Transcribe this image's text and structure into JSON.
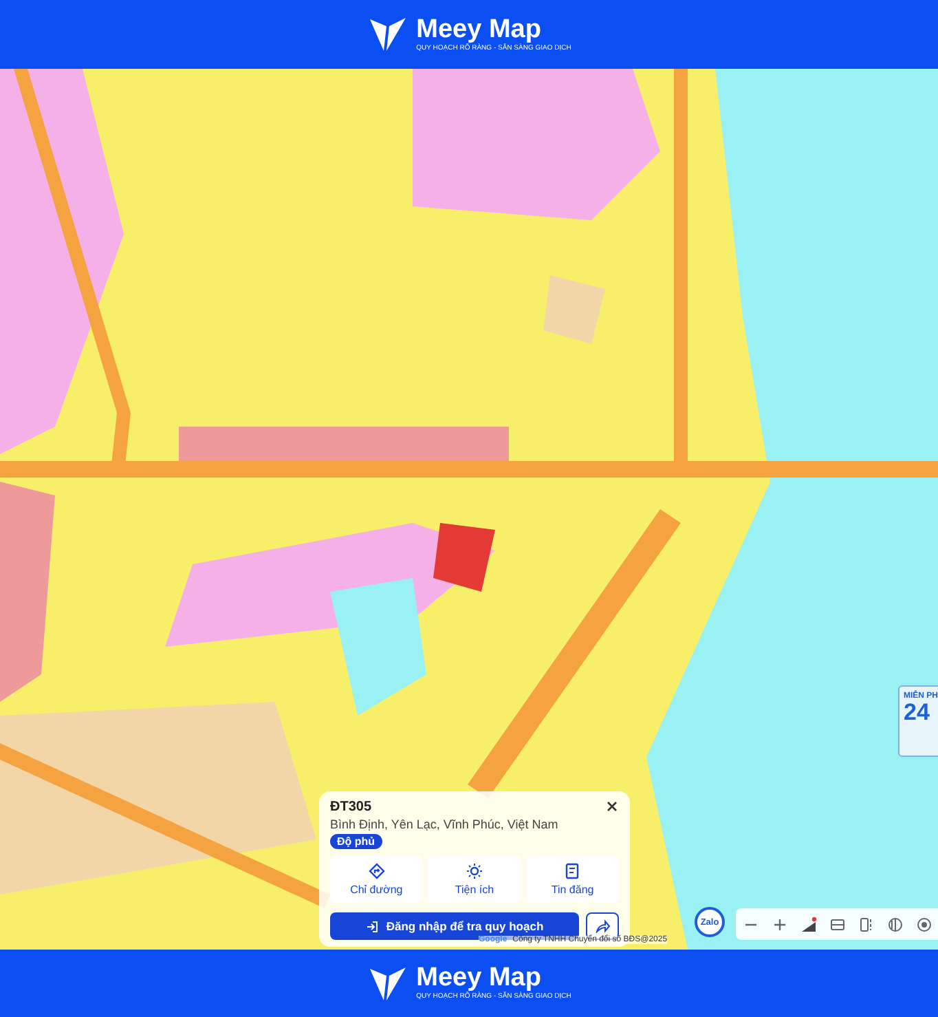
{
  "header": {
    "brand": "Meey Map",
    "tagline": "QUY HOẠCH RÕ RÀNG - SẴN SÀNG GIAO DỊCH"
  },
  "promo": {
    "label": "MIỄN PH",
    "number": "24"
  },
  "place_card": {
    "title": "ĐT305",
    "address": "Bình Định, Yên Lạc, Vĩnh Phúc, Việt Nam",
    "badge": "Độ phủ",
    "actions": [
      {
        "kind": "directions",
        "label": "Chỉ đường"
      },
      {
        "kind": "amenities",
        "label": "Tiện ích"
      },
      {
        "kind": "listings",
        "label": "Tin đăng"
      }
    ],
    "login_button": "Đăng nhập để tra quy hoạch"
  },
  "attribution": {
    "provider": "Google",
    "copyright": "Công ty TNHH Chuyển đổi số BĐS@2025"
  },
  "zalo_button": "Zalo",
  "footer": {
    "brand": "Meey Map",
    "tagline": "QUY HOẠCH RÕ RÀNG - SẴN SÀNG GIAO DỊCH"
  }
}
